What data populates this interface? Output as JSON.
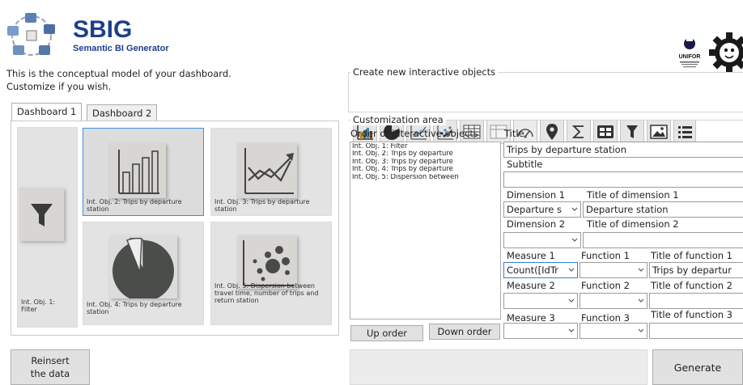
{
  "header": {
    "logo_title": "SBIG",
    "logo_subtitle": "Semantic BI Generator",
    "partner_logo_text": "UNIFOR"
  },
  "intro": {
    "line1": "This is the conceptual model of your dashboard.",
    "line2": "Customize if you wish."
  },
  "tabs": [
    {
      "label": "Dashboard 1",
      "active": true
    },
    {
      "label": "Dashboard 2",
      "active": false
    }
  ],
  "dashboard_cards": [
    {
      "caption": "Int. Obj. 1:\nFilter",
      "icon": "funnel-icon"
    },
    {
      "caption": "Int. Obj. 2: Trips by departure station",
      "icon": "bar-chart-icon",
      "selected": true
    },
    {
      "caption": "Int. Obj. 3: Trips by departure station",
      "icon": "line-chart-icon"
    },
    {
      "caption": "Int. Obj. 4: Trips by departure station",
      "icon": "pie-chart-icon"
    },
    {
      "caption": "Int. Obj. 5: Dispersion between travel time, number of trips and return station",
      "icon": "bubble-chart-icon"
    }
  ],
  "create_group": {
    "label": "Create new interactive objects",
    "tools": [
      "bar-chart-icon",
      "pie-chart-icon",
      "line-chart-icon",
      "scatter-icon",
      "table-icon",
      "pivot-table-icon",
      "gauge-icon",
      "map-pin-icon",
      "sum-icon",
      "calculator-icon",
      "filter-icon",
      "image-icon",
      "list-icon"
    ]
  },
  "customization": {
    "label": "Customization area",
    "order_label": "Order of interactive objects",
    "objects": [
      "Int. Obj. 1: Filter",
      "Int. Obj. 2: Trips by departure",
      "Int. Obj. 3: Trips by departure",
      "Int. Obj. 4: Trips by departure",
      "Int. Obj. 5: Dispersion between"
    ],
    "title_label": "Title",
    "title_value": "Trips by departure station",
    "subtitle_label": "Subtitle",
    "subtitle_value": "",
    "dimension1_label": "Dimension 1",
    "dimension1_value": "Departure s",
    "dimension1_title_label": "Title of dimension 1",
    "dimension1_title_value": "Departure station",
    "dimension2_label": "Dimension 2",
    "dimension2_title_label": "Title of dimension 2",
    "measure1_label": "Measure 1",
    "measure1_value": "Count([IdTr",
    "function1_label": "Function 1",
    "function1_title_label": "Title of function 1",
    "function1_title_value": "Trips by departur",
    "measure2_label": "Measure 2",
    "function2_label": "Function 2",
    "function2_title_label": "Title of function 2",
    "measure3_label": "Measure 3",
    "function3_label": "Function 3",
    "function3_title_label": "Title of function 3",
    "up_order": "Up order",
    "down_order": "Down order"
  },
  "footer": {
    "reinsert": "Reinsert\nthe data",
    "generate": "Generate"
  }
}
